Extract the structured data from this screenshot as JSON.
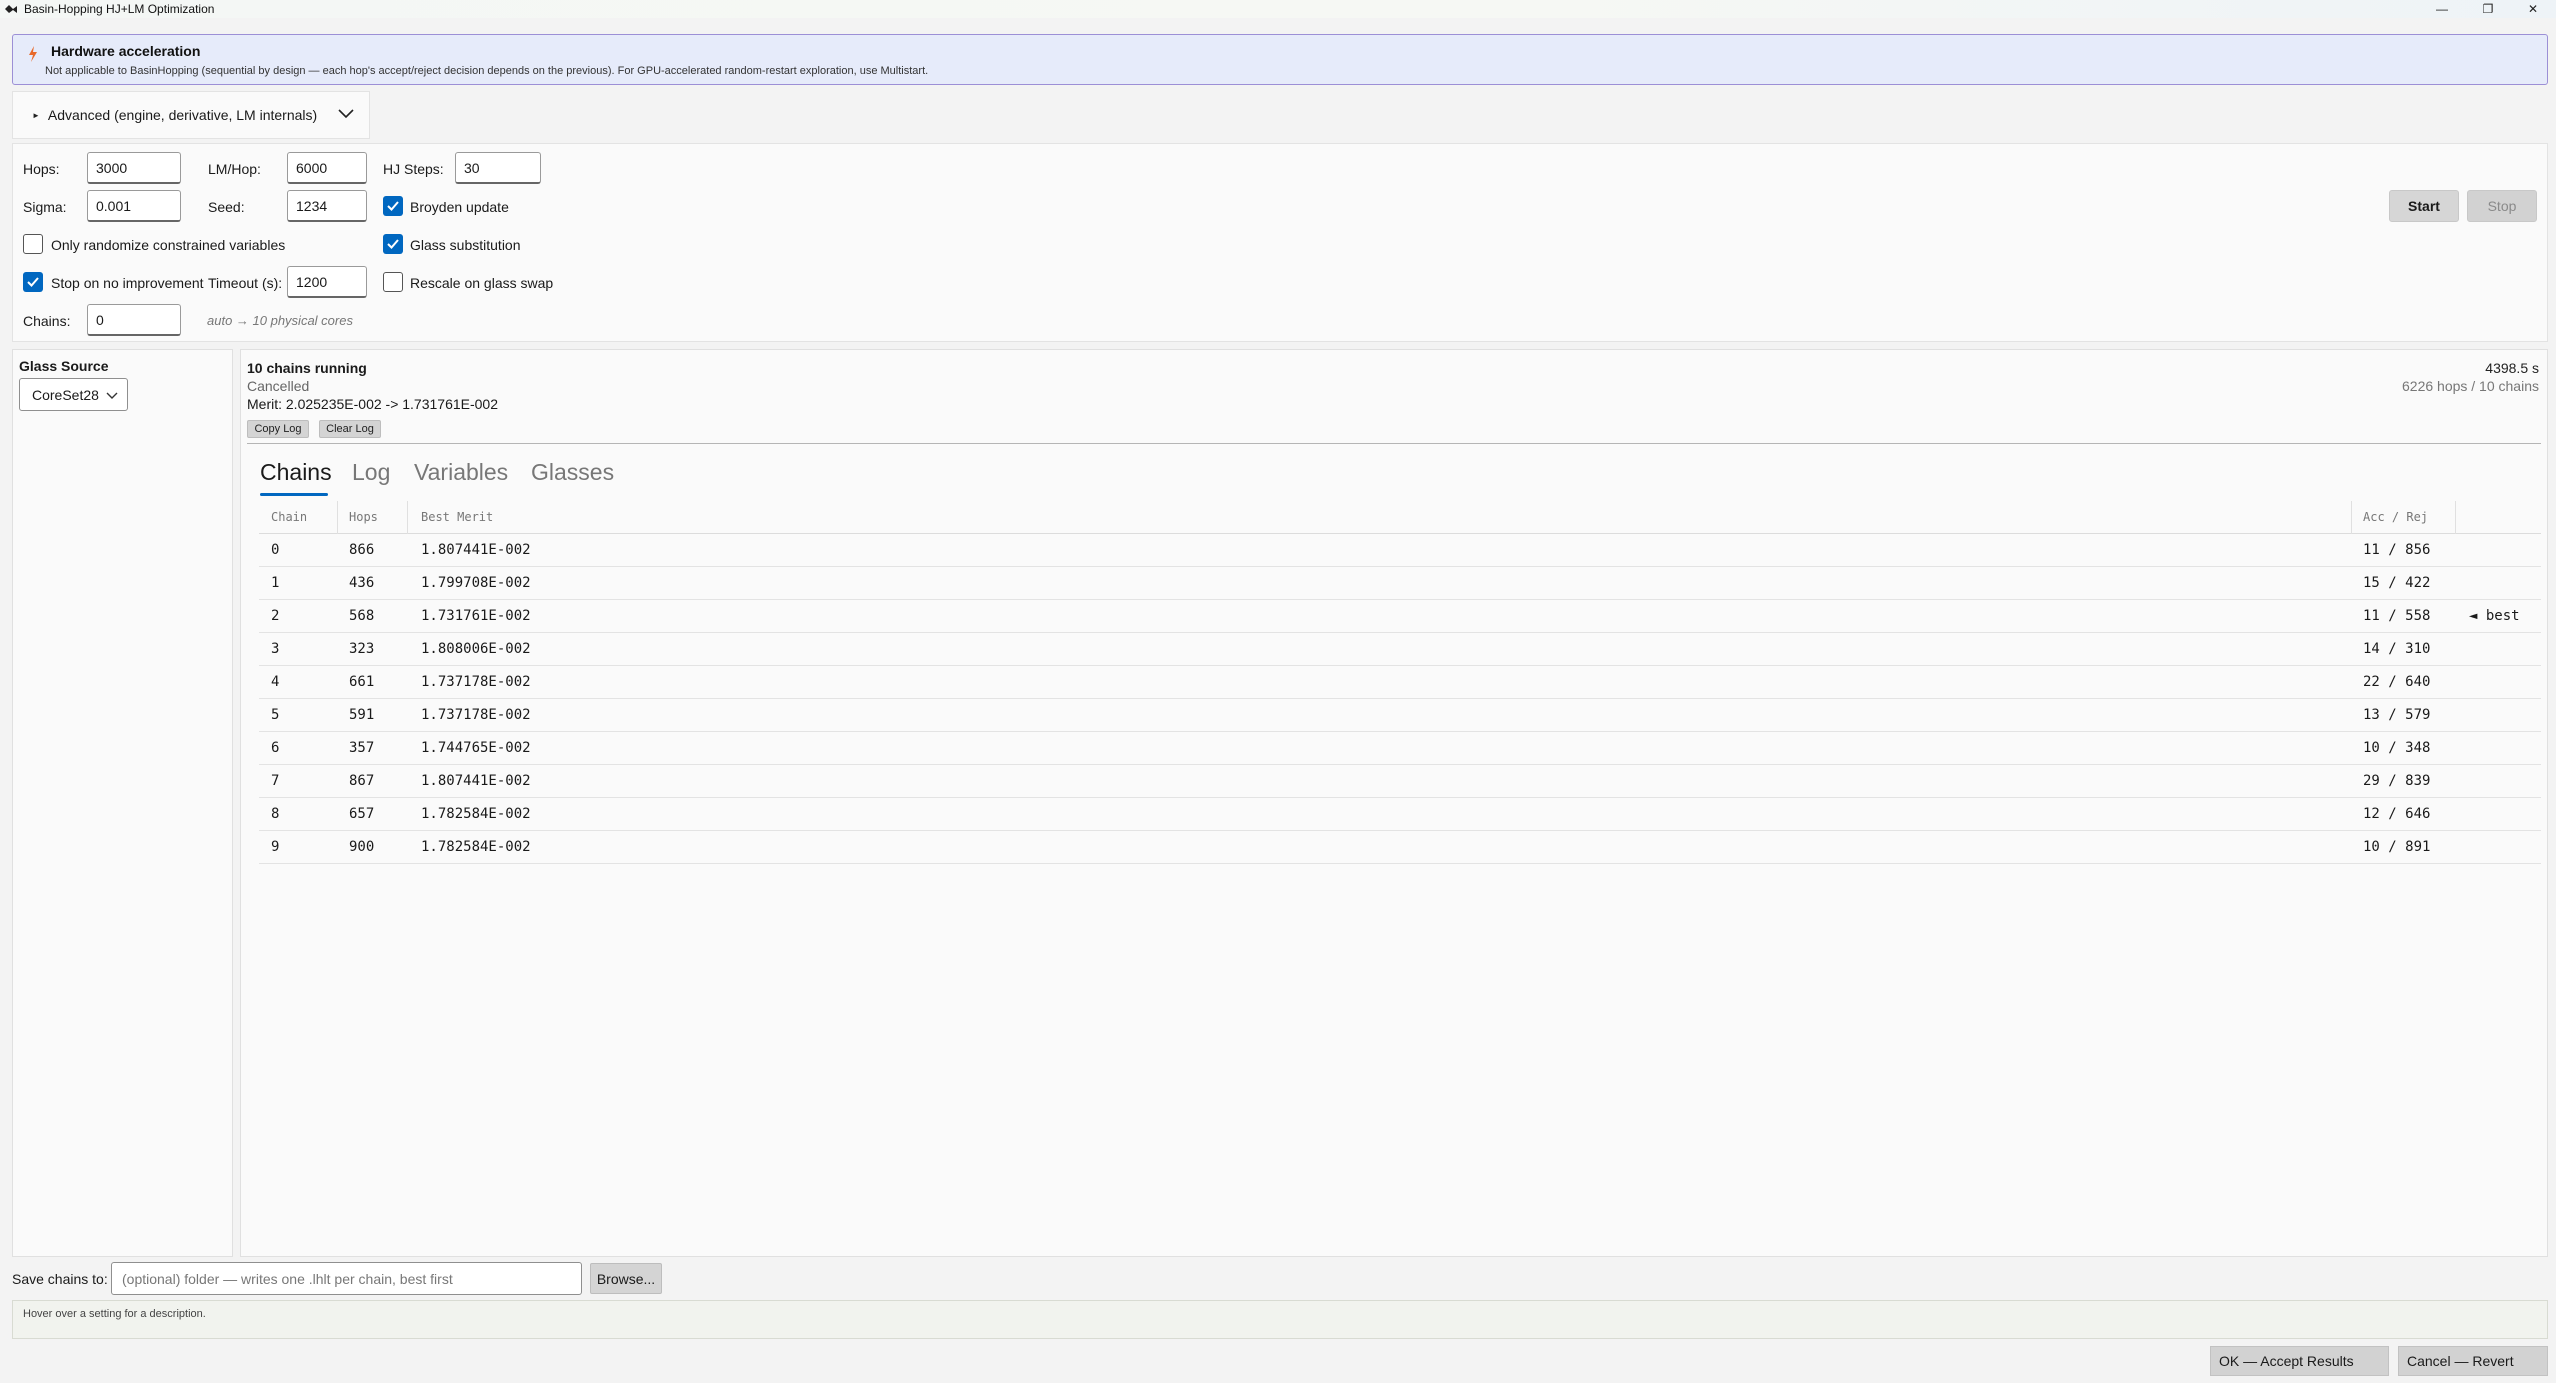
{
  "window": {
    "title": "Basin-Hopping HJ+LM Optimization",
    "controls": {
      "minimize": "—",
      "maximize": "❐",
      "close": "✕"
    }
  },
  "banner": {
    "icon": "lightning-bolt-icon",
    "title": "Hardware acceleration",
    "description": "Not applicable to BasinHopping (sequential by design — each hop's accept/reject decision depends on the previous). For GPU-accelerated random-restart exploration, use Multistart."
  },
  "advanced": {
    "label": "Advanced (engine, derivative, LM internals)"
  },
  "params": {
    "hops_label": "Hops:",
    "hops_value": "3000",
    "lmhop_label": "LM/Hop:",
    "lmhop_value": "6000",
    "hjsteps_label": "HJ Steps:",
    "hjsteps_value": "30",
    "sigma_label": "Sigma:",
    "sigma_value": "0.001",
    "seed_label": "Seed:",
    "seed_value": "1234",
    "broyden_label": "Broyden update",
    "broyden_checked": true,
    "randomize_label": "Only randomize constrained variables",
    "randomize_checked": false,
    "glass_sub_label": "Glass substitution",
    "glass_sub_checked": true,
    "stop_label": "Stop on no improvement",
    "stop_checked": true,
    "timeout_label": "Timeout (s):",
    "timeout_value": "1200",
    "rescale_label": "Rescale on glass swap",
    "rescale_checked": false,
    "chains_label": "Chains:",
    "chains_value": "0",
    "chains_hint": "auto → 10 physical cores",
    "start_label": "Start",
    "stop_btn_label": "Stop"
  },
  "glass": {
    "title": "Glass Source",
    "selected": "CoreSet28"
  },
  "status": {
    "line1": "10 chains running",
    "line2": "Cancelled",
    "line3": "Merit: 2.025235E-002 -> 1.731761E-002",
    "time": "4398.5 s",
    "summary": "6226 hops / 10 chains",
    "copy_log": "Copy Log",
    "clear_log": "Clear Log"
  },
  "tabs": [
    {
      "label": "Chains"
    },
    {
      "label": "Log"
    },
    {
      "label": "Variables"
    },
    {
      "label": "Glasses"
    }
  ],
  "table": {
    "headers": [
      "Chain",
      "Hops",
      "Best Merit",
      "Acc / Rej",
      ""
    ],
    "rows": [
      {
        "chain": "0",
        "hops": "866",
        "merit": "1.807441E-002",
        "accrej": "11 / 856",
        "flag": ""
      },
      {
        "chain": "1",
        "hops": "436",
        "merit": "1.799708E-002",
        "accrej": "15 / 422",
        "flag": ""
      },
      {
        "chain": "2",
        "hops": "568",
        "merit": "1.731761E-002",
        "accrej": "11 / 558",
        "flag": "◄ best"
      },
      {
        "chain": "3",
        "hops": "323",
        "merit": "1.808006E-002",
        "accrej": "14 / 310",
        "flag": ""
      },
      {
        "chain": "4",
        "hops": "661",
        "merit": "1.737178E-002",
        "accrej": "22 / 640",
        "flag": ""
      },
      {
        "chain": "5",
        "hops": "591",
        "merit": "1.737178E-002",
        "accrej": "13 / 579",
        "flag": ""
      },
      {
        "chain": "6",
        "hops": "357",
        "merit": "1.744765E-002",
        "accrej": "10 / 348",
        "flag": ""
      },
      {
        "chain": "7",
        "hops": "867",
        "merit": "1.807441E-002",
        "accrej": "29 / 839",
        "flag": ""
      },
      {
        "chain": "8",
        "hops": "657",
        "merit": "1.782584E-002",
        "accrej": "12 / 646",
        "flag": ""
      },
      {
        "chain": "9",
        "hops": "900",
        "merit": "1.782584E-002",
        "accrej": "10 / 891",
        "flag": ""
      }
    ]
  },
  "save": {
    "label": "Save chains to:",
    "placeholder": "(optional) folder — writes one .lhlt per chain, best first",
    "value": "",
    "browse": "Browse..."
  },
  "hover_text": "Hover over a setting for a description.",
  "footer": {
    "ok": "OK — Accept Results",
    "cancel": "Cancel — Revert"
  },
  "colors": {
    "accent": "#0067c0",
    "banner_border": "#9c8fd6",
    "banner_bg": "#e6ebfa",
    "bolt": "#e8692a"
  }
}
